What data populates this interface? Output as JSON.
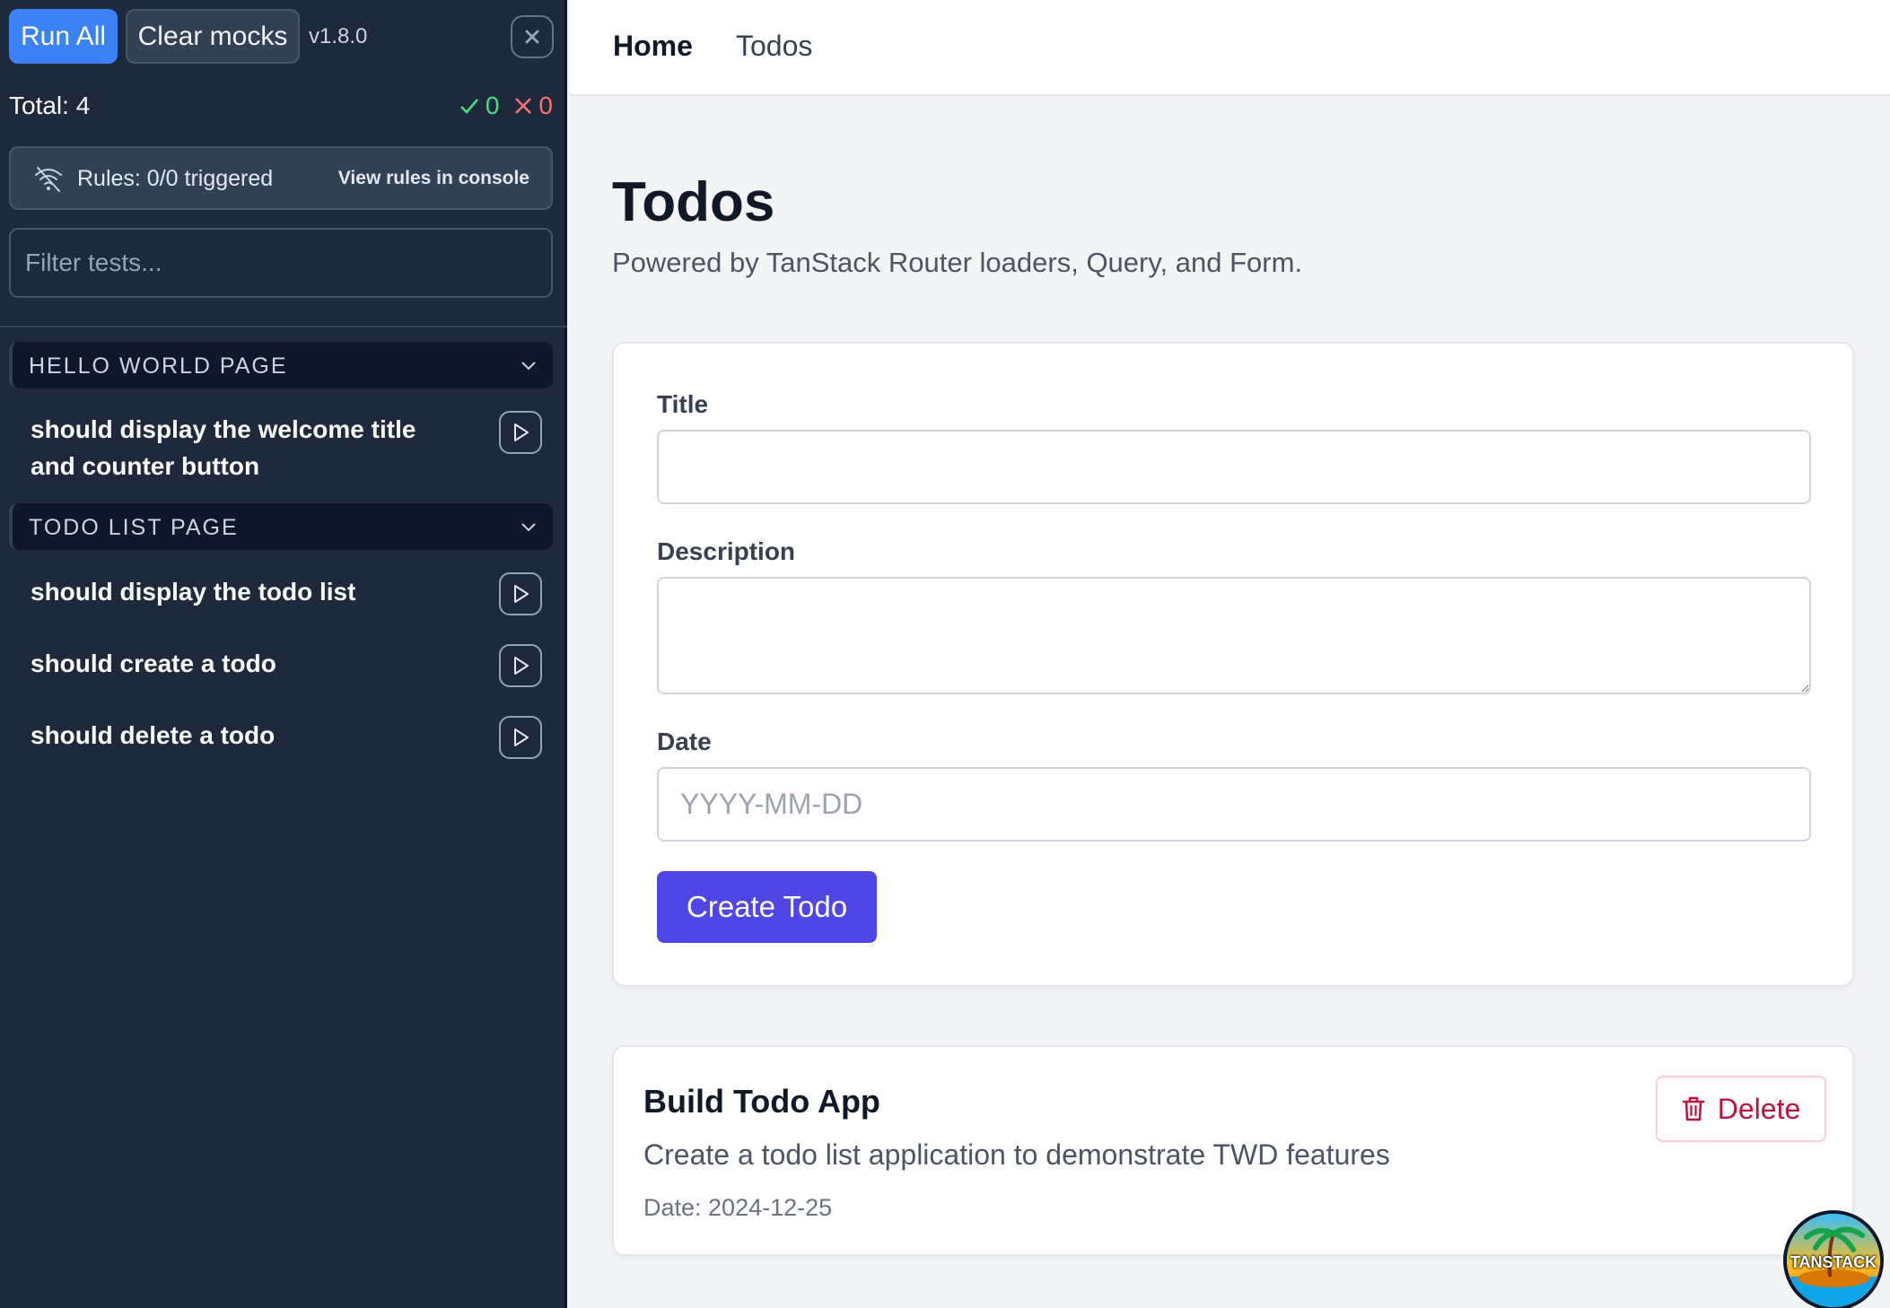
{
  "panel": {
    "run_all_label": "Run All",
    "clear_mocks_label": "Clear mocks",
    "version": "v1.8.0",
    "total_label": "Total: 4",
    "passed_count": "0",
    "failed_count": "0",
    "rules_text": "Rules: 0/0 triggered",
    "rules_link": "View rules in console",
    "filter_placeholder": "Filter tests...",
    "groups": [
      {
        "title": "HELLO WORLD PAGE",
        "tests": [
          {
            "name": "should display the welcome title and counter button"
          }
        ]
      },
      {
        "title": "TODO LIST PAGE",
        "tests": [
          {
            "name": "should display the todo list"
          },
          {
            "name": "should create a todo"
          },
          {
            "name": "should delete a todo"
          }
        ]
      }
    ]
  },
  "nav": {
    "home": "Home",
    "todos": "Todos"
  },
  "page": {
    "title": "Todos",
    "subtitle": "Powered by TanStack Router loaders, Query, and Form."
  },
  "form": {
    "title_label": "Title",
    "title_value": "",
    "description_label": "Description",
    "description_value": "",
    "date_label": "Date",
    "date_placeholder": "YYYY-MM-DD",
    "submit_label": "Create Todo"
  },
  "todos": [
    {
      "title": "Build Todo App",
      "description": "Create a todo list application to demonstrate TWD features",
      "date": "Date: 2024-12-25",
      "delete_label": "Delete"
    }
  ],
  "logo": {
    "text": "TANSTACK"
  },
  "colors": {
    "panel_bg": "#1e293b",
    "run_all_bg": "#3b82f6",
    "pass": "#4ade80",
    "fail": "#f87171",
    "primary_button": "#4f46e5",
    "delete": "#be123c"
  }
}
